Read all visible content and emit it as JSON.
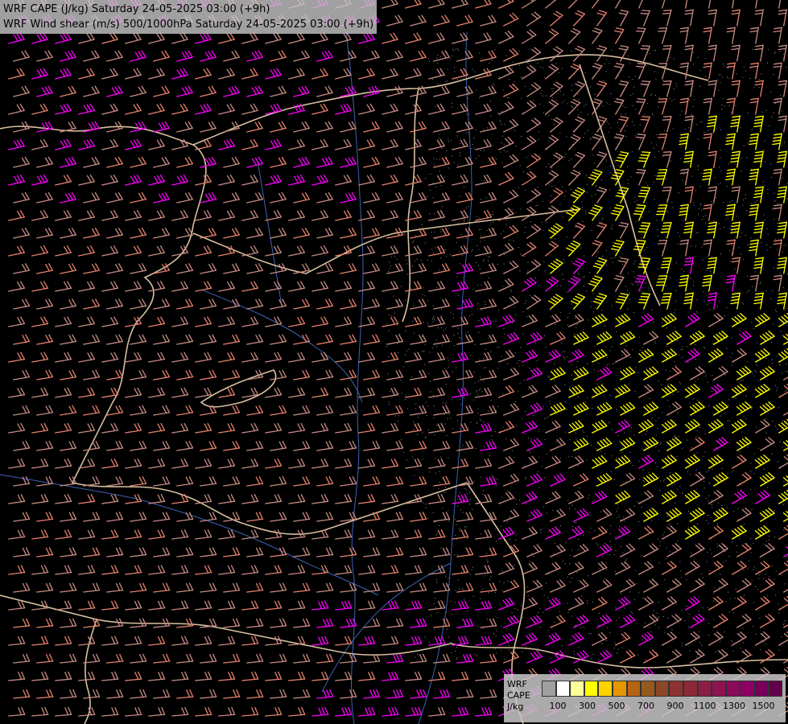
{
  "titles": {
    "line1": "WRF CAPE (J/kg) Saturday 24-05-2025 03:00 (+9h)",
    "line2": "WRF Wind shear (m/s) 500/1000hPa Saturday 24-05-2025 03:00 (+9h)"
  },
  "legend": {
    "model": "WRF",
    "field": "CAPE",
    "unit": "J/kg",
    "colors": [
      "#a0a0a0",
      "#ffffff",
      "#ffff99",
      "#ffff00",
      "#ffd200",
      "#e69600",
      "#b46414",
      "#965a1e",
      "#8c4628",
      "#8c3232",
      "#8c2837",
      "#8c1e46",
      "#8c1450",
      "#8c0a5a",
      "#8c0064",
      "#78005a",
      "#64004b"
    ],
    "tick_labels": [
      "100",
      "300",
      "500",
      "700",
      "900",
      "1100",
      "1300",
      "1500"
    ]
  },
  "map_colors": {
    "background": "#000000",
    "borders": "#d8c0a0",
    "rivers": "#3c64b4",
    "barbs_weak": "#c88c82",
    "barbs_moderate": "#e6826e",
    "barbs_strong": "#ff00ff",
    "barbs_extreme": "#ffff00",
    "stipple": "#909090"
  }
}
